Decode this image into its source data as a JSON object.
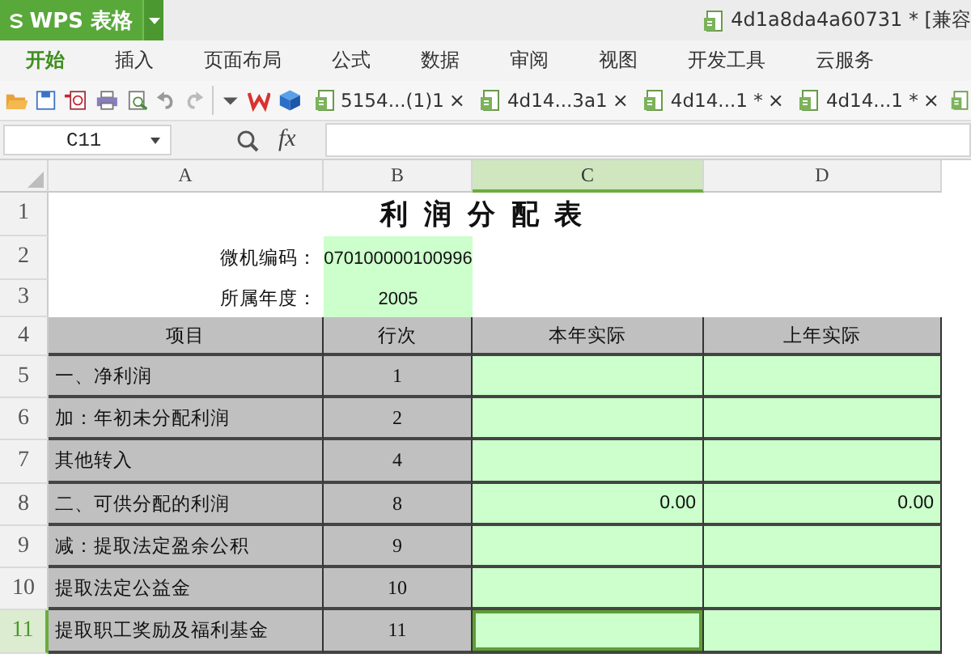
{
  "app_button": {
    "label": "WPS 表格"
  },
  "document_title": "4d1a8da4a60731 * [兼容",
  "menu": [
    {
      "label": "开始",
      "selected": true
    },
    {
      "label": "插入",
      "selected": false
    },
    {
      "label": "页面布局",
      "selected": false
    },
    {
      "label": "公式",
      "selected": false
    },
    {
      "label": "数据",
      "selected": false
    },
    {
      "label": "审阅",
      "selected": false
    },
    {
      "label": "视图",
      "selected": false
    },
    {
      "label": "开发工具",
      "selected": false
    },
    {
      "label": "云服务",
      "selected": false
    }
  ],
  "doc_tabs": [
    {
      "label": "5154...(1)1",
      "close": "×"
    },
    {
      "label": "4d14...3a1",
      "close": "×"
    },
    {
      "label": "4d14...1 *",
      "close": "×"
    },
    {
      "label": "4d14...1 *",
      "close": "×"
    }
  ],
  "formula_bar": {
    "name_box": "C11",
    "fx": "fx"
  },
  "sheet": {
    "columns": [
      {
        "label": "A",
        "selected": false
      },
      {
        "label": "B",
        "selected": false
      },
      {
        "label": "C",
        "selected": true
      },
      {
        "label": "D",
        "selected": false
      }
    ],
    "rows": [
      {
        "header": "1",
        "selected": false,
        "cells": [
          {
            "kind": "blank"
          },
          {
            "kind": "title",
            "text": "利 润 分 配 表"
          },
          {
            "kind": "blank"
          }
        ]
      },
      {
        "header": "2",
        "selected": false,
        "cells": [
          {
            "kind": "label",
            "text": "微机编码："
          },
          {
            "kind": "input",
            "text": "070100000100996"
          },
          {
            "kind": "blank"
          },
          {
            "kind": "blank"
          }
        ]
      },
      {
        "header": "3",
        "selected": false,
        "cells": [
          {
            "kind": "label",
            "text": "所属年度："
          },
          {
            "kind": "input",
            "text": "2005"
          },
          {
            "kind": "blank"
          },
          {
            "kind": "blank"
          }
        ]
      },
      {
        "header": "4",
        "selected": false,
        "cells": [
          {
            "kind": "header",
            "text": "项目"
          },
          {
            "kind": "header",
            "text": "行次"
          },
          {
            "kind": "header",
            "text": "本年实际"
          },
          {
            "kind": "header",
            "text": "上年实际"
          }
        ]
      },
      {
        "header": "5",
        "selected": false,
        "cells": [
          {
            "kind": "item",
            "text": "一、净利润"
          },
          {
            "kind": "number",
            "text": "1"
          },
          {
            "kind": "amount"
          },
          {
            "kind": "amount"
          }
        ]
      },
      {
        "header": "6",
        "selected": false,
        "cells": [
          {
            "kind": "item",
            "text": "加：年初未分配利润"
          },
          {
            "kind": "number",
            "text": "2"
          },
          {
            "kind": "amount"
          },
          {
            "kind": "amount"
          }
        ]
      },
      {
        "header": "7",
        "selected": false,
        "cells": [
          {
            "kind": "item",
            "text": "其他转入"
          },
          {
            "kind": "number",
            "text": "4"
          },
          {
            "kind": "amount"
          },
          {
            "kind": "amount"
          }
        ]
      },
      {
        "header": "8",
        "selected": false,
        "cells": [
          {
            "kind": "item",
            "text": "二、可供分配的利润"
          },
          {
            "kind": "number",
            "text": "8"
          },
          {
            "kind": "amount",
            "text": "0.00"
          },
          {
            "kind": "amount",
            "text": "0.00"
          }
        ]
      },
      {
        "header": "9",
        "selected": false,
        "cells": [
          {
            "kind": "item",
            "text": "减：提取法定盈余公积"
          },
          {
            "kind": "number",
            "text": "9"
          },
          {
            "kind": "amount"
          },
          {
            "kind": "amount"
          }
        ]
      },
      {
        "header": "10",
        "selected": false,
        "cells": [
          {
            "kind": "item",
            "text": "提取法定公益金"
          },
          {
            "kind": "number",
            "text": "10"
          },
          {
            "kind": "amount"
          },
          {
            "kind": "amount"
          }
        ]
      },
      {
        "header": "11",
        "selected": true,
        "cells": [
          {
            "kind": "item",
            "text": "提取职工奖励及福利基金"
          },
          {
            "kind": "number",
            "text": "11"
          },
          {
            "kind": "amount"
          },
          {
            "kind": "amount"
          }
        ]
      }
    ]
  }
}
